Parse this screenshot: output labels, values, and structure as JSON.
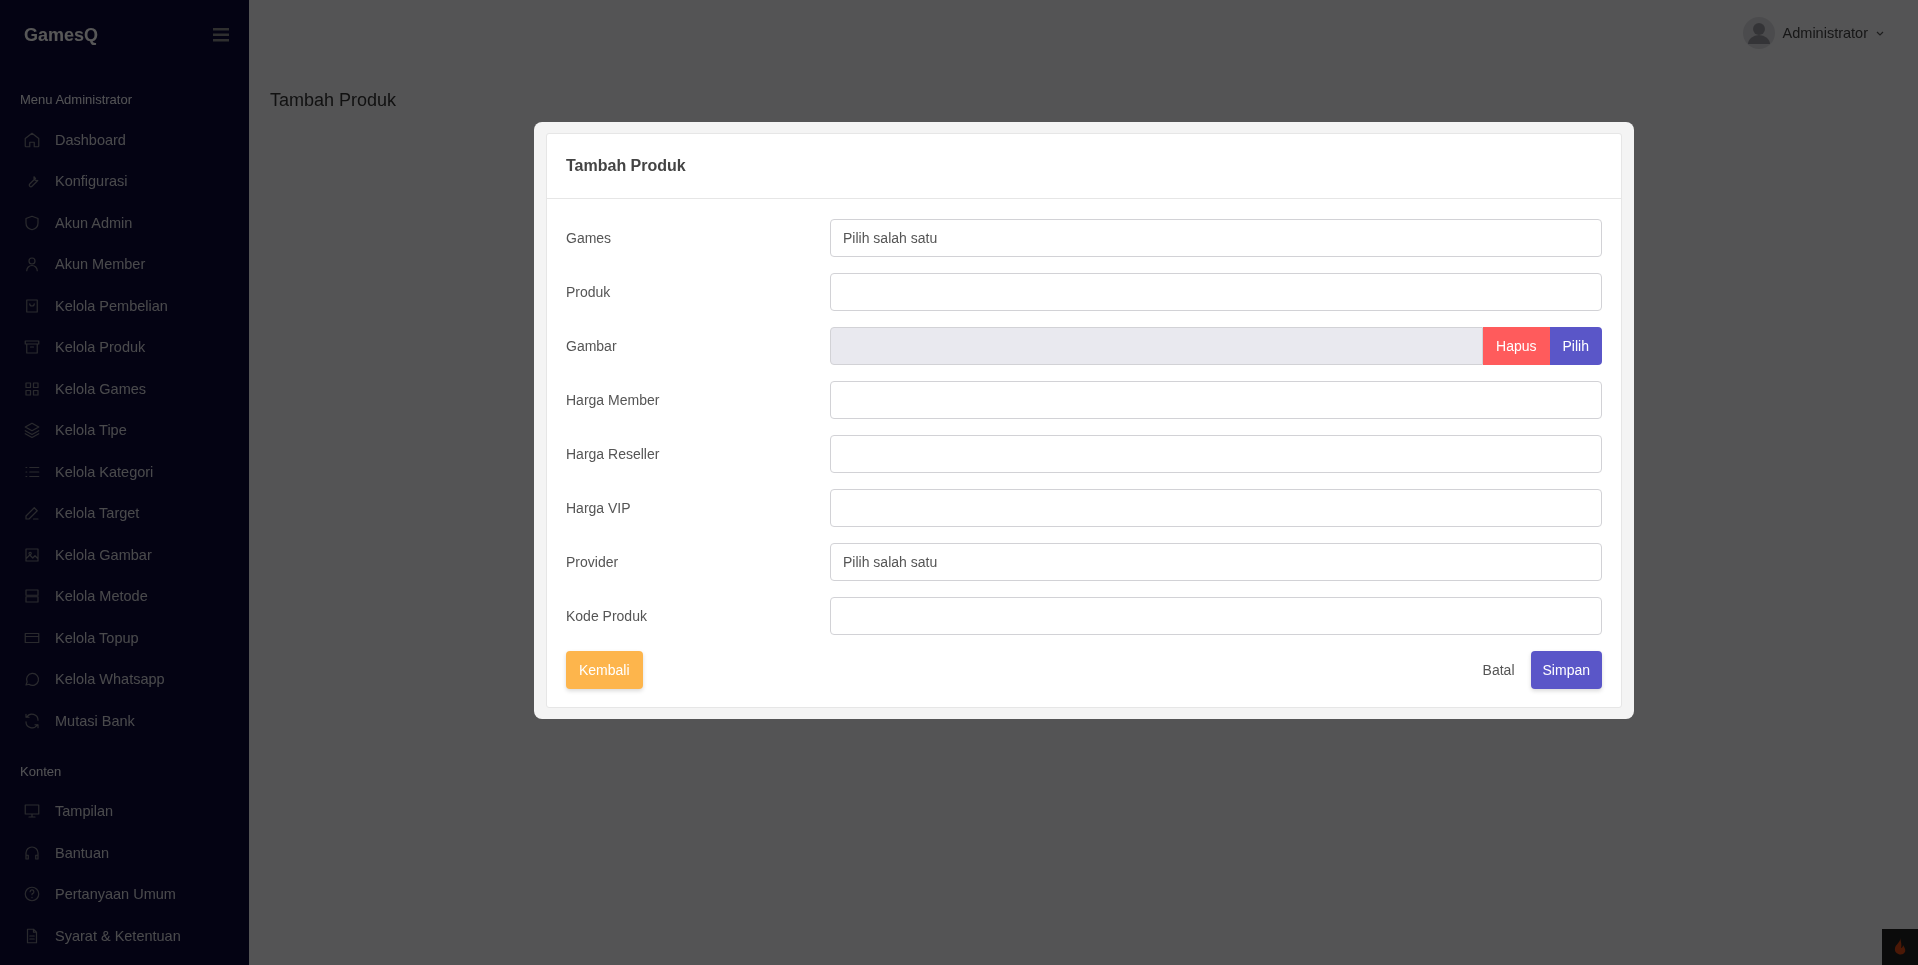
{
  "sidebar": {
    "brand": "GamesQ",
    "sections": [
      {
        "title": "Menu Administrator",
        "items": [
          {
            "label": "Dashboard"
          },
          {
            "label": "Konfigurasi"
          },
          {
            "label": "Akun Admin"
          },
          {
            "label": "Akun Member"
          },
          {
            "label": "Kelola Pembelian"
          },
          {
            "label": "Kelola Produk"
          },
          {
            "label": "Kelola Games"
          },
          {
            "label": "Kelola Tipe"
          },
          {
            "label": "Kelola Kategori"
          },
          {
            "label": "Kelola Target"
          },
          {
            "label": "Kelola Gambar"
          },
          {
            "label": "Kelola Metode"
          },
          {
            "label": "Kelola Topup"
          },
          {
            "label": "Kelola Whatsapp"
          },
          {
            "label": "Mutasi Bank"
          }
        ]
      },
      {
        "title": "Konten",
        "items": [
          {
            "label": "Tampilan"
          },
          {
            "label": "Bantuan"
          },
          {
            "label": "Pertanyaan Umum"
          },
          {
            "label": "Syarat & Ketentuan"
          }
        ]
      }
    ]
  },
  "topbar": {
    "user": "Administrator"
  },
  "page_title": "Tambah Produk",
  "modal": {
    "title": "Tambah Produk",
    "fields": [
      {
        "label": "Games",
        "kind": "select",
        "value": "Pilih salah satu"
      },
      {
        "label": "Produk",
        "kind": "text"
      },
      {
        "label": "Gambar",
        "kind": "file",
        "buttons": [
          "Hapus",
          "Pilih"
        ]
      },
      {
        "label": "Harga Member",
        "kind": "text"
      },
      {
        "label": "Harga Reseller",
        "kind": "text"
      },
      {
        "label": "Harga VIP",
        "kind": "text"
      },
      {
        "label": "Provider",
        "kind": "select",
        "value": "Pilih salah satu"
      },
      {
        "label": "Kode Produk",
        "kind": "text"
      }
    ],
    "back_button": "Kembali",
    "cancel_button": "Batal",
    "save_button": "Simpan"
  }
}
